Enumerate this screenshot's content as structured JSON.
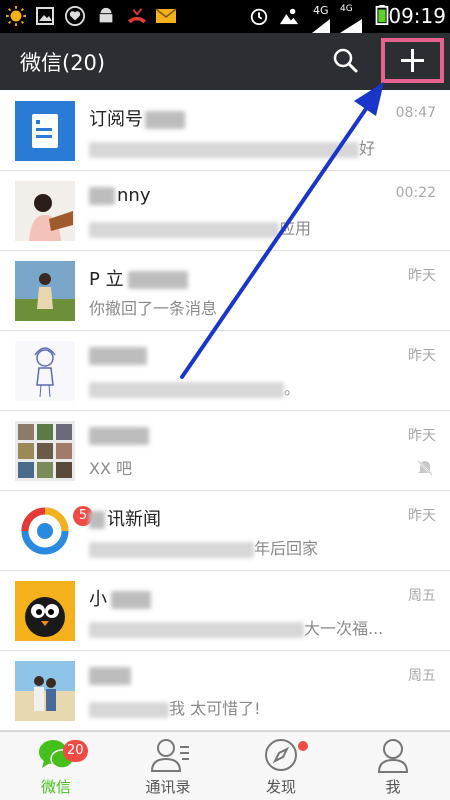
{
  "status_bar": {
    "time": "09:19",
    "network": "4G",
    "network2": "4G"
  },
  "header": {
    "title": "微信(20)"
  },
  "chats": [
    {
      "name": "订阅号",
      "preview": "好",
      "time": "08:47",
      "badge": "",
      "muted": false
    },
    {
      "name": "nny",
      "preview": "应用",
      "time": "00:22",
      "badge": "",
      "muted": false
    },
    {
      "name": "P 立",
      "preview": "你撤回了一条消息",
      "time": "昨天",
      "badge": "",
      "muted": false
    },
    {
      "name": "",
      "preview": "。",
      "time": "昨天",
      "badge": "",
      "muted": false
    },
    {
      "name": "",
      "preview": "XX 吧",
      "time": "昨天",
      "badge": "",
      "muted": true
    },
    {
      "name": "讯新闻",
      "preview": "年后回家",
      "time": "昨天",
      "badge": "5",
      "muted": false
    },
    {
      "name": "小",
      "preview": "大一次福...",
      "time": "周五",
      "badge": "",
      "muted": false
    },
    {
      "name": "",
      "preview": "我 太可惜了!",
      "time": "周五",
      "badge": "",
      "muted": false
    }
  ],
  "tabs": [
    {
      "label": "微信",
      "badge": "20"
    },
    {
      "label": "通讯录"
    },
    {
      "label": "发现"
    },
    {
      "label": "我"
    }
  ],
  "colors": {
    "header_bg": "#2b2e33",
    "accent_green": "#45c01a",
    "badge_red": "#f04a45",
    "highlight_pink": "#e8628f",
    "arrow_blue": "#1a35c9"
  },
  "icons": [
    "search-icon",
    "plus-icon",
    "chat-tab-icon",
    "contacts-tab-icon",
    "discover-tab-icon",
    "me-tab-icon",
    "mute-icon"
  ]
}
